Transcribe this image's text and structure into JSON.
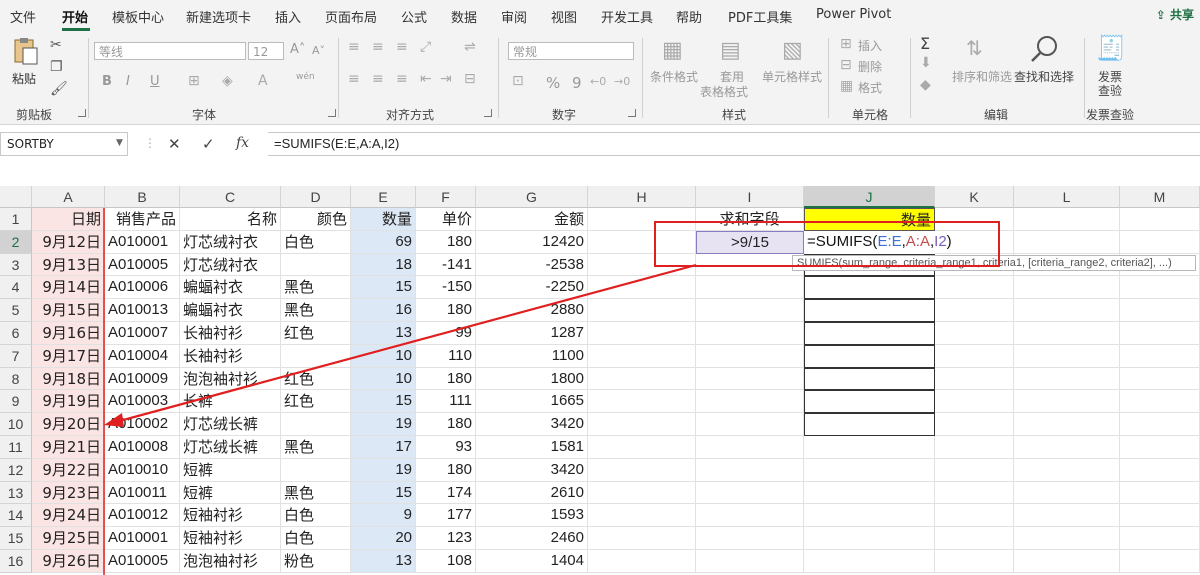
{
  "menu": {
    "tabs": [
      "文件",
      "开始",
      "模板中心",
      "新建选项卡",
      "插入",
      "页面布局",
      "公式",
      "数据",
      "审阅",
      "视图",
      "开发工具",
      "帮助",
      "PDF工具集",
      "Power Pivot"
    ],
    "active": "开始",
    "share": "共享"
  },
  "ribbon": {
    "clipboard": {
      "paste": "粘贴",
      "label": "剪贴板"
    },
    "font": {
      "name": "等线",
      "size": "12",
      "bold": "B",
      "italic": "I",
      "underline": "U",
      "label": "字体",
      "grow": "A˄",
      "shrink": "A˅",
      "wen": "wén"
    },
    "align": {
      "label": "对齐方式"
    },
    "number": {
      "format": "常规",
      "percent": "%",
      "comma": "9",
      "label": "数字"
    },
    "styles": {
      "cond": "条件格式",
      "table": "套用",
      "table2": "表格格式",
      "cellstyle": "单元格样式",
      "label": "样式"
    },
    "cells": {
      "insert": "插入",
      "delete": "删除",
      "format": "格式",
      "label": "单元格"
    },
    "editing": {
      "sum": "Σ",
      "sort": "排序和筛选",
      "find": "查找和选择",
      "label": "编辑"
    },
    "invoice": {
      "btn1": "发票",
      "btn2": "查验",
      "label": "发票查验"
    }
  },
  "formula_bar": {
    "name_box": "SORTBY",
    "cancel": "✕",
    "enter": "✓",
    "fx": "fx",
    "formula": "=SUMIFS(E:E,A:A,I2)"
  },
  "columns": [
    "A",
    "B",
    "C",
    "D",
    "E",
    "F",
    "G",
    "H",
    "I",
    "J",
    "K",
    "L",
    "M"
  ],
  "headers": {
    "A": "日期",
    "B": "销售产品",
    "C": "名称",
    "D": "颜色",
    "E": "数量",
    "F": "单价",
    "G": "金额"
  },
  "rows": [
    {
      "n": "2",
      "A": "9月12日",
      "B": "A010001",
      "C": "灯芯绒衬衣",
      "D": "白色",
      "E": "69",
      "F": "180",
      "G": "12420"
    },
    {
      "n": "3",
      "A": "9月13日",
      "B": "A010005",
      "C": "灯芯绒衬衣",
      "D": "",
      "E": "18",
      "F": "-141",
      "G": "-2538"
    },
    {
      "n": "4",
      "A": "9月14日",
      "B": "A010006",
      "C": "蝙蝠衬衣",
      "D": "黑色",
      "E": "15",
      "F": "-150",
      "G": "-2250"
    },
    {
      "n": "5",
      "A": "9月15日",
      "B": "A010013",
      "C": "蝙蝠衬衣",
      "D": "黑色",
      "E": "16",
      "F": "180",
      "G": "2880"
    },
    {
      "n": "6",
      "A": "9月16日",
      "B": "A010007",
      "C": "长袖衬衫",
      "D": "红色",
      "E": "13",
      "F": "99",
      "G": "1287"
    },
    {
      "n": "7",
      "A": "9月17日",
      "B": "A010004",
      "C": "长袖衬衫",
      "D": "",
      "E": "10",
      "F": "110",
      "G": "1100"
    },
    {
      "n": "8",
      "A": "9月18日",
      "B": "A010009",
      "C": "泡泡袖衬衫",
      "D": "红色",
      "E": "10",
      "F": "180",
      "G": "1800"
    },
    {
      "n": "9",
      "A": "9月19日",
      "B": "A010003",
      "C": "长裤",
      "D": "红色",
      "E": "15",
      "F": "111",
      "G": "1665"
    },
    {
      "n": "10",
      "A": "9月20日",
      "B": "A010002",
      "C": "灯芯绒长裤",
      "D": "",
      "E": "19",
      "F": "180",
      "G": "3420"
    },
    {
      "n": "11",
      "A": "9月21日",
      "B": "A010008",
      "C": "灯芯绒长裤",
      "D": "黑色",
      "E": "17",
      "F": "93",
      "G": "1581"
    },
    {
      "n": "12",
      "A": "9月22日",
      "B": "A010010",
      "C": "短裤",
      "D": "",
      "E": "19",
      "F": "180",
      "G": "3420"
    },
    {
      "n": "13",
      "A": "9月23日",
      "B": "A010011",
      "C": "短裤",
      "D": "黑色",
      "E": "15",
      "F": "174",
      "G": "2610"
    },
    {
      "n": "14",
      "A": "9月24日",
      "B": "A010012",
      "C": "短袖衬衫",
      "D": "白色",
      "E": "9",
      "F": "177",
      "G": "1593"
    },
    {
      "n": "15",
      "A": "9月25日",
      "B": "A010001",
      "C": "短袖衬衫",
      "D": "白色",
      "E": "20",
      "F": "123",
      "G": "2460"
    },
    {
      "n": "16",
      "A": "9月26日",
      "B": "A010005",
      "C": "泡泡袖衬衫",
      "D": "粉色",
      "E": "13",
      "F": "108",
      "G": "1404"
    }
  ],
  "side_table": {
    "I1": "求和字段",
    "J1": "数量",
    "I2": ">9/15",
    "J2_formula": "=SUMIFS(E:E,A:A,I2)"
  },
  "tooltip": "SUMIFS(sum_range, criteria_range1, criteria1, [criteria_range2, criteria2], ...)",
  "colors": {
    "accent": "#1e7145",
    "highlight_yellow": "#ffff00",
    "pink_fill": "#fbe4e4",
    "blue_fill": "#dde8f6",
    "annotation_red": "#e02020"
  }
}
